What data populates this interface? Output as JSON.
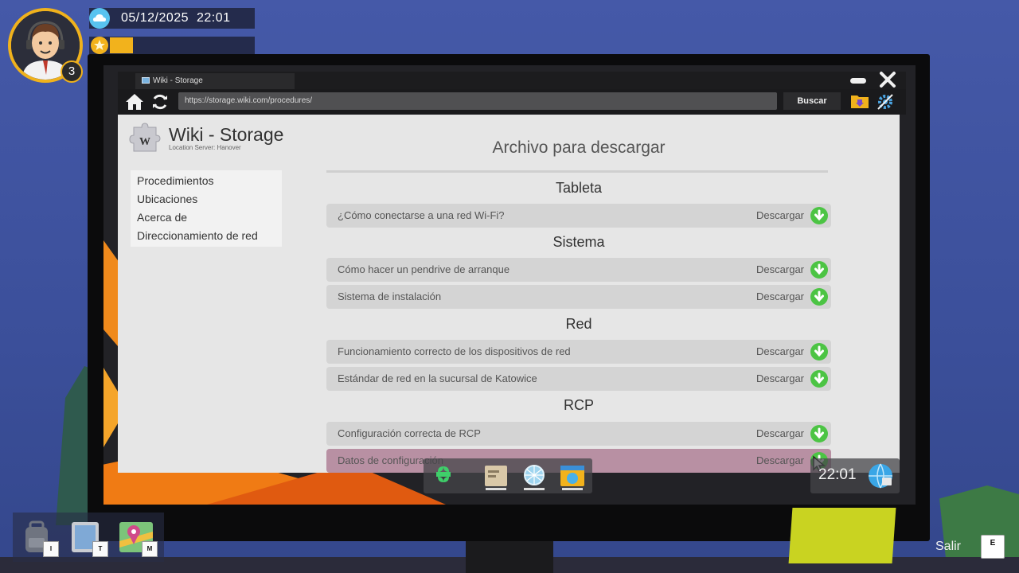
{
  "hud": {
    "level": "3",
    "date": "05/12/2025",
    "time": "22:01",
    "xp_fraction": 0.16,
    "inventory_keys": [
      "I",
      "T",
      "M"
    ],
    "exit_label": "Salir",
    "exit_key": "E"
  },
  "browser": {
    "tab_title": "Wiki - Storage",
    "url": "https://storage.wiki.com/procedures/",
    "search_label": "Buscar"
  },
  "site": {
    "title": "Wiki - Storage",
    "subtitle": "Location Server: Hanover",
    "nav": [
      "Procedimientos",
      "Ubicaciones",
      "Acerca de",
      "Direccionamiento de red"
    ]
  },
  "content": {
    "title": "Archivo para descargar",
    "download_label": "Descargar",
    "sections": [
      {
        "title": "Tableta",
        "items": [
          "¿Cómo conectarse a una red Wi-Fi?"
        ]
      },
      {
        "title": "Sistema",
        "items": [
          "Cómo hacer un pendrive de arranque",
          "Sistema de instalación"
        ]
      },
      {
        "title": "Red",
        "items": [
          "Funcionamiento correcto de los dispositivos de red",
          "Estándar de red en la sucursal de Katowice"
        ]
      },
      {
        "title": "RCP",
        "items": [
          "Configuración correcta de RCP",
          "Datos de configuración"
        ]
      }
    ]
  },
  "taskbar": {
    "clock": "22:01"
  },
  "colors": {
    "accent_orange": "#f0b21c",
    "download_green": "#4cc444",
    "hover_row": "#b890a3"
  }
}
